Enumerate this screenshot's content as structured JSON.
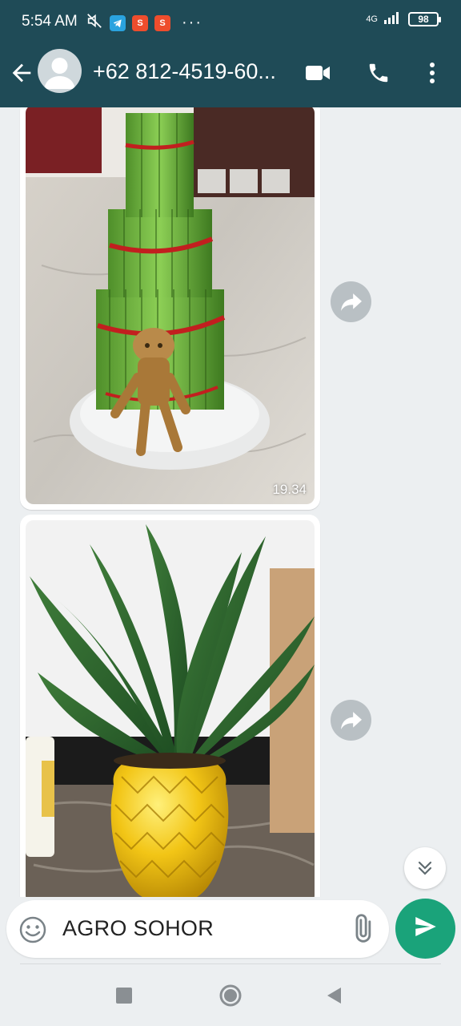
{
  "status_bar": {
    "time": "5:54 AM",
    "network": "4G",
    "battery": "98",
    "more": "···"
  },
  "header": {
    "contact_name": "+62 812-4519-60..."
  },
  "messages": [
    {
      "type": "image",
      "subject": "lucky bamboo tower with groot figurine",
      "time": "19.34"
    },
    {
      "type": "image",
      "subject": "green plant in yellow pineapple pot",
      "time": ""
    }
  ],
  "composer": {
    "text": "AGRO SOHOR"
  },
  "colors": {
    "header_bg": "#1f4b57",
    "send_button": "#1aa37a",
    "chat_bg": "#eceff1"
  },
  "icons": [
    "back-arrow-icon",
    "video-call-icon",
    "phone-icon",
    "more-vert-icon",
    "forward-icon",
    "scroll-down-icon",
    "emoji-icon",
    "attach-icon",
    "send-icon",
    "recent-apps-icon",
    "home-icon",
    "back-icon"
  ]
}
